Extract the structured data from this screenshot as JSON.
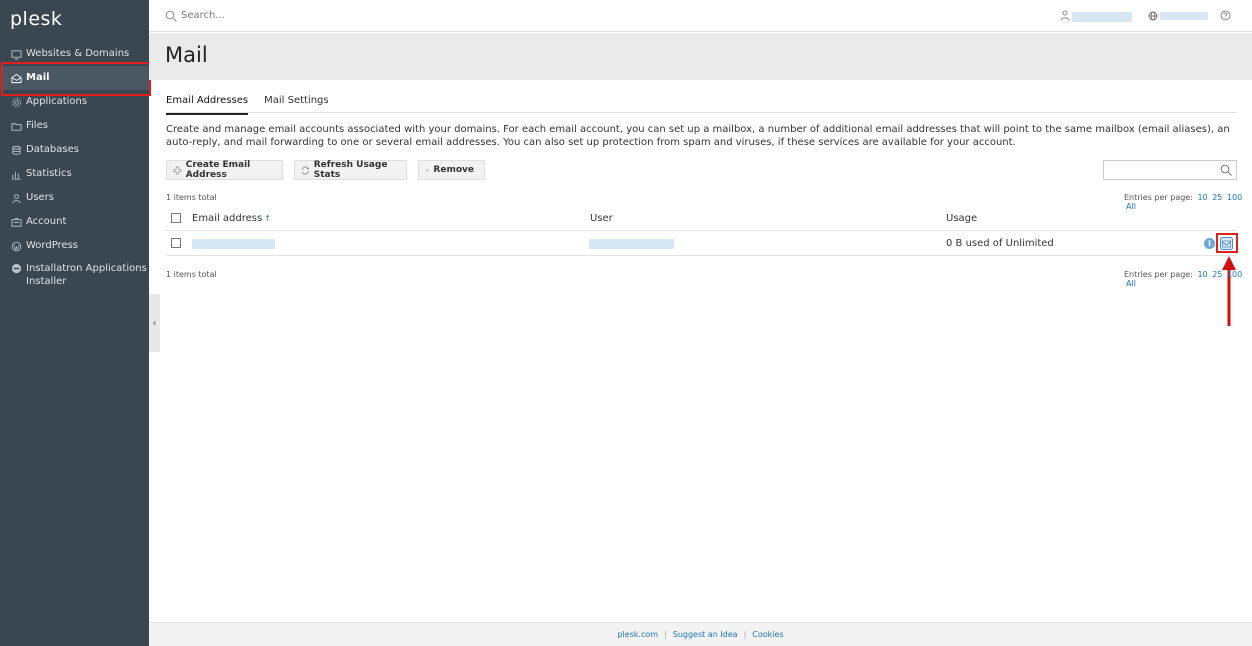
{
  "sidebar": {
    "logo": "plesk",
    "items": [
      {
        "label": "Websites & Domains",
        "icon": "monitor-icon"
      },
      {
        "label": "Mail",
        "icon": "envelope-icon",
        "active": true
      },
      {
        "label": "Applications",
        "icon": "gear-icon"
      },
      {
        "label": "Files",
        "icon": "folder-icon"
      },
      {
        "label": "Databases",
        "icon": "database-icon"
      },
      {
        "label": "Statistics",
        "icon": "bar-chart-icon"
      },
      {
        "label": "Users",
        "icon": "user-icon"
      },
      {
        "label": "Account",
        "icon": "id-card-icon"
      },
      {
        "label": "WordPress",
        "icon": "wordpress-icon"
      },
      {
        "label": "Installatron Applications Installer",
        "icon": "installatron-icon"
      }
    ],
    "collapse_glyph": "‹"
  },
  "topbar": {
    "search_placeholder": "Search..."
  },
  "page": {
    "title": "Mail"
  },
  "tabs": [
    {
      "label": "Email Addresses",
      "active": true
    },
    {
      "label": "Mail Settings",
      "active": false
    }
  ],
  "description": "Create and manage email accounts associated with your domains. For each email account, you can set up a mailbox, a number of additional email addresses that will point to the same mailbox (email aliases), an auto-reply, and mail forwarding to one or several email addresses. You can also set up protection from spam and viruses, if these services are available for your account.",
  "toolbar": {
    "create_label": "Create Email Address",
    "refresh_label": "Refresh Usage Stats",
    "remove_label": "Remove"
  },
  "list": {
    "items_total_top": "1 items total",
    "items_total_bottom": "1 items total",
    "entries_per_page_label": "Entries per page:",
    "page_sizes": [
      "10",
      "25",
      "100",
      "All"
    ],
    "columns": {
      "email": "Email address",
      "user": "User",
      "usage": "Usage"
    },
    "rows": [
      {
        "usage": "0 B used of Unlimited"
      }
    ]
  },
  "footer": {
    "links": [
      "plesk.com",
      "Suggest an Idea",
      "Cookies"
    ]
  },
  "colors": {
    "sidebar_bg": "#3a4650",
    "link": "#1a74c4",
    "highlight": "#e02020"
  }
}
